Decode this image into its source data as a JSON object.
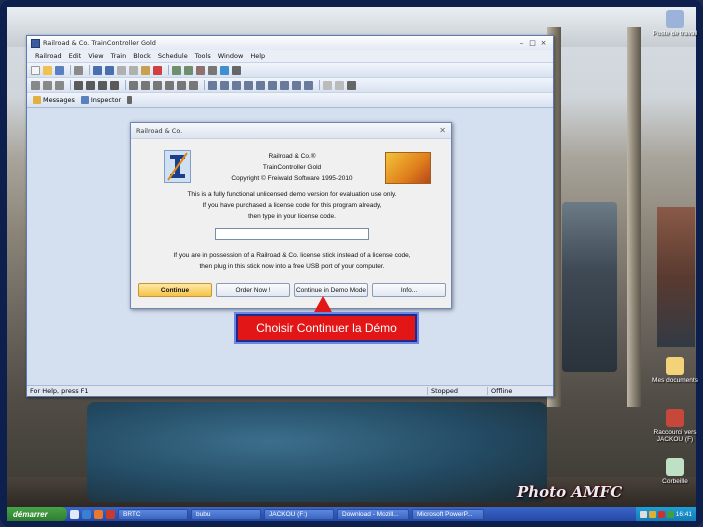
{
  "app": {
    "title": "Railroad & Co. TrainController Gold",
    "menu": [
      "Railroad",
      "Edit",
      "View",
      "Train",
      "Block",
      "Schedule",
      "Tools",
      "Window",
      "Help"
    ],
    "tabs": [
      "Messages",
      "Inspector"
    ],
    "status": {
      "help": "For Help, press F1",
      "state": "Stopped",
      "connection": "Offline"
    }
  },
  "dialog": {
    "title": "Railroad & Co.",
    "product_line1": "Railroad & Co.®",
    "product_line2": "TrainController Gold",
    "copyright": "Copyright © Freiwald Software 1995-2010",
    "msg1": "This is a fully functional unlicensed demo version for evaluation use only.",
    "msg2": "If you have purchased a license code for this program already,",
    "msg3": "then type in your license code.",
    "license_value": "",
    "stick1": "If you are in possession of a Railroad & Co. license stick instead of a license code,",
    "stick2": "then plug in this stick now into a free USB port of your computer.",
    "buttons": {
      "continue": "Continue",
      "order": "Order Now !",
      "demo": "Continue in Demo Mode",
      "info": "Info..."
    }
  },
  "callout": {
    "text": "Choisir Continuer la Démo",
    "color": "#e21616"
  },
  "desktop": {
    "icons": [
      {
        "label": "Poste de travail"
      },
      {
        "label": "Mes documents"
      },
      {
        "label": "Raccourci vers JACKOU (F)"
      },
      {
        "label": "Corbeille"
      }
    ],
    "watermark": "Photo AMFC"
  },
  "taskbar": {
    "start": "démarrer",
    "items": [
      "BRTC",
      "bubu",
      "JACKOU (F:)",
      "Download - Mozill...",
      "Microsoft PowerP..."
    ],
    "clock": "16:41"
  }
}
